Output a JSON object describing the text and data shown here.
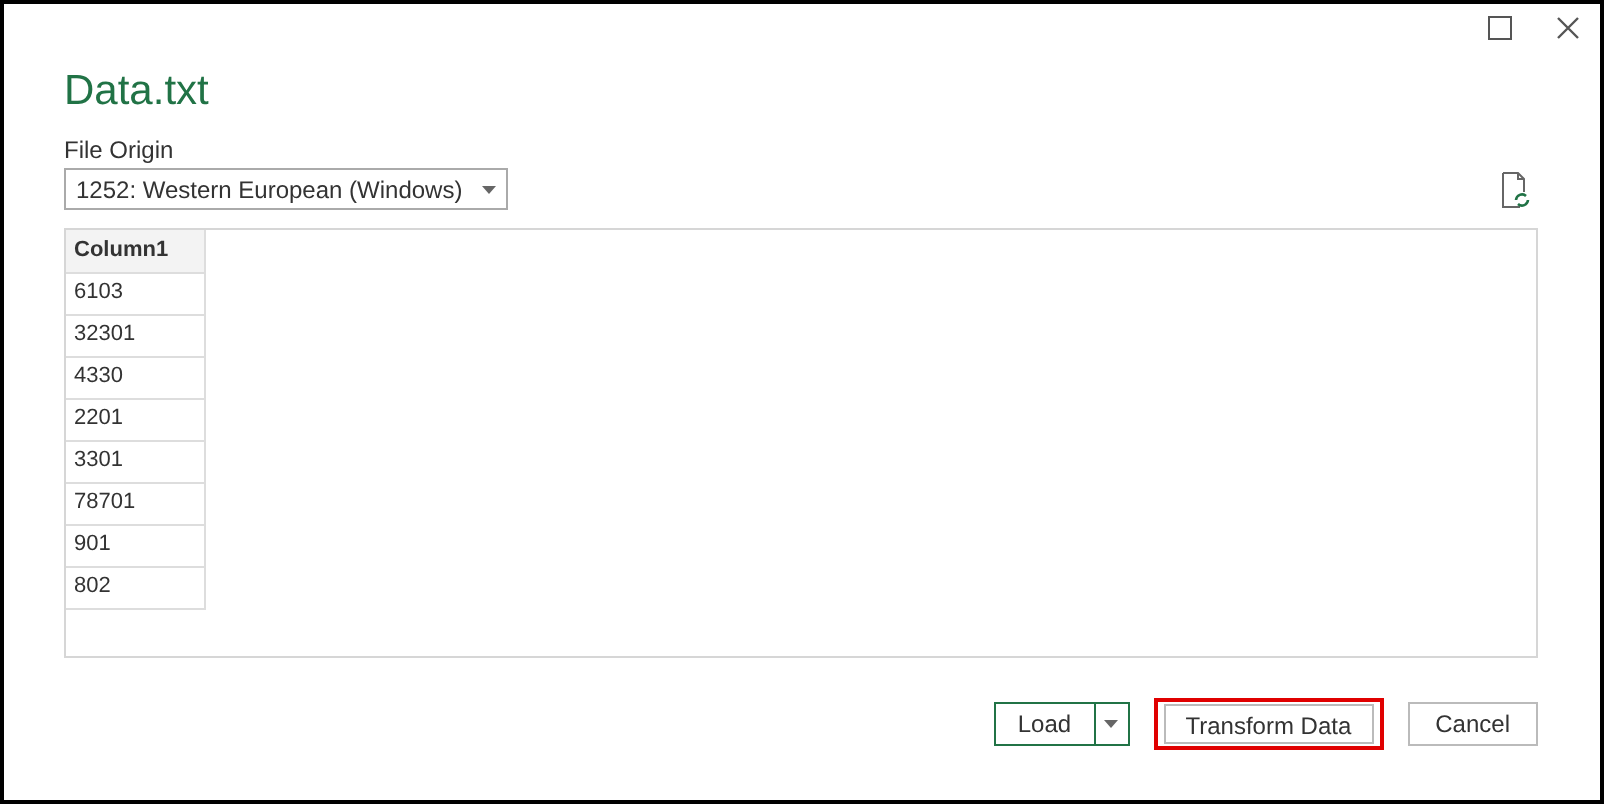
{
  "window": {
    "title": "Data.txt"
  },
  "file_origin": {
    "label": "File Origin",
    "value": "1252: Western European (Windows)"
  },
  "table": {
    "columns": [
      "Column1"
    ],
    "rows": [
      [
        "6103"
      ],
      [
        "32301"
      ],
      [
        "4330"
      ],
      [
        "2201"
      ],
      [
        "3301"
      ],
      [
        "78701"
      ],
      [
        "901"
      ],
      [
        "802"
      ]
    ]
  },
  "buttons": [
    {
      "kind": "split",
      "label": "Load",
      "highlighted": false
    },
    {
      "kind": "plain",
      "label": "Transform Data",
      "highlighted": true
    },
    {
      "kind": "plain",
      "label": "Cancel",
      "highlighted": false
    }
  ]
}
